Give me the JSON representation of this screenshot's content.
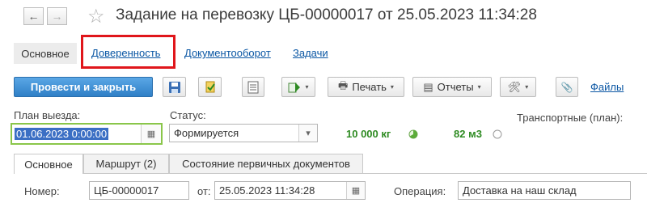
{
  "window": {
    "title": "Задание на перевозку ЦБ-00000017 от 25.05.2023 11:34:28"
  },
  "nav": {
    "back_icon": "←",
    "forward_icon": "→",
    "star_icon": "☆"
  },
  "tabs": [
    {
      "label": "Основное"
    },
    {
      "label": "Доверенность"
    },
    {
      "label": "Документооборот"
    },
    {
      "label": "Задачи"
    }
  ],
  "toolbar": {
    "post_close_label": "Провести и закрыть",
    "print_label": "Печать",
    "reports_label": "Отчеты",
    "files_label": "Файлы",
    "print_icon": "🖶",
    "reports_icon": "▤",
    "settings_icon": "🛠",
    "caret": "▾",
    "attach_icon": "📎"
  },
  "form": {
    "departure_label": "План выезда:",
    "departure_value": "01.06.2023  0:00:00",
    "calendar_icon": "▦",
    "status_label": "Статус:",
    "status_value": "Формируется",
    "status_dropdown": "▾",
    "weight": "10 000 кг",
    "volume": "82 м3",
    "transport_label": "Транспортные (план):"
  },
  "inner_tabs": [
    {
      "label": "Основное"
    },
    {
      "label": "Маршрут (2)"
    },
    {
      "label": "Состояние первичных документов"
    }
  ],
  "bottom": {
    "number_label": "Номер:",
    "number_value": "ЦБ-00000017",
    "from_label": "от:",
    "from_value": "25.05.2023 11:34:28",
    "operation_label": "Операция:",
    "operation_value": "Доставка на наш склад"
  },
  "colors": {
    "accent": "#2f7fc6",
    "highlight": "#e0161b",
    "link": "#0b57a4",
    "green": "#2e8b22"
  }
}
